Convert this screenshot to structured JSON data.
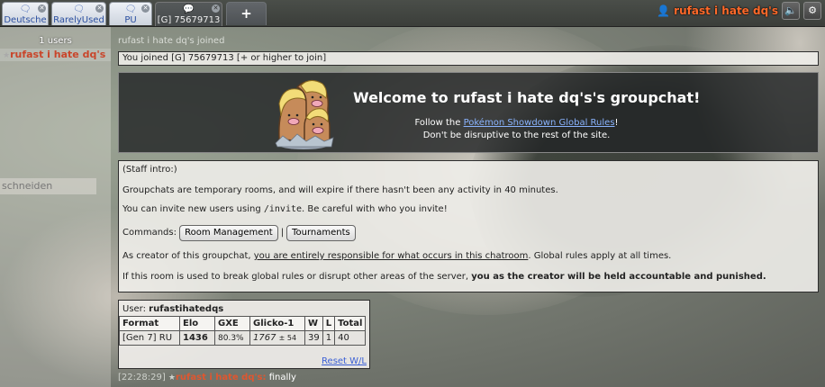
{
  "tabs": [
    {
      "label": "Deutsche"
    },
    {
      "label": "RarelyUsed"
    },
    {
      "label": "PU"
    },
    {
      "label": "[G] 75679713"
    }
  ],
  "plus_label": "+",
  "user": {
    "name": "rufast i hate dq's"
  },
  "userlist": {
    "count": "1 users",
    "users": [
      {
        "rank": "★",
        "name": "rufast i hate dq's"
      }
    ],
    "ghost_text": "schneiden"
  },
  "chat": {
    "joined_notice": "rufast i hate dq's joined",
    "you_joined": "You joined [G] 75679713 [+ or higher to join]",
    "welcome": {
      "title": "Welcome to rufast i hate dq's's groupchat!",
      "follow_prefix": "Follow the ",
      "rules_link": "Pokémon Showdown Global Rules",
      "follow_suffix": "!",
      "line2": "Don't be disruptive to the rest of the site."
    },
    "staff": {
      "header": "(Staff intro:)",
      "p1": "Groupchats are temporary rooms, and will expire if there hasn't been any activity in 40 minutes.",
      "p2_a": "You can invite new users using ",
      "p2_cmd": "/invite",
      "p2_b": ". Be careful with who you invite!",
      "commands_label": "Commands:",
      "btn_room": "Room Management",
      "btn_sep": "|",
      "btn_tour": "Tournaments",
      "p4_a": "As creator of this groupchat, ",
      "p4_u": "you are entirely responsible for what occurs in this chatroom",
      "p4_b": ". Global rules apply at all times.",
      "p5_a": "If this room is used to break global rules or disrupt other areas of the server, ",
      "p5_b": "you as the creator will be held accountable and punished."
    },
    "stats": {
      "user_label": "User: ",
      "user_name": "rufastihatedqs",
      "headers": [
        "Format",
        "Elo",
        "GXE",
        "Glicko-1",
        "W",
        "L",
        "Total"
      ],
      "row": {
        "format": "[Gen 7] RU",
        "elo": "1436",
        "gxe": "80.3%",
        "glicko": "1767",
        "glicko_dev": "± 54",
        "w": "39",
        "l": "1",
        "total": "40"
      },
      "reset": "Reset W/L"
    },
    "message": {
      "time": "[22:28:29]",
      "rank": "★",
      "name": "rufast i hate dq's:",
      "text": "finally"
    }
  }
}
